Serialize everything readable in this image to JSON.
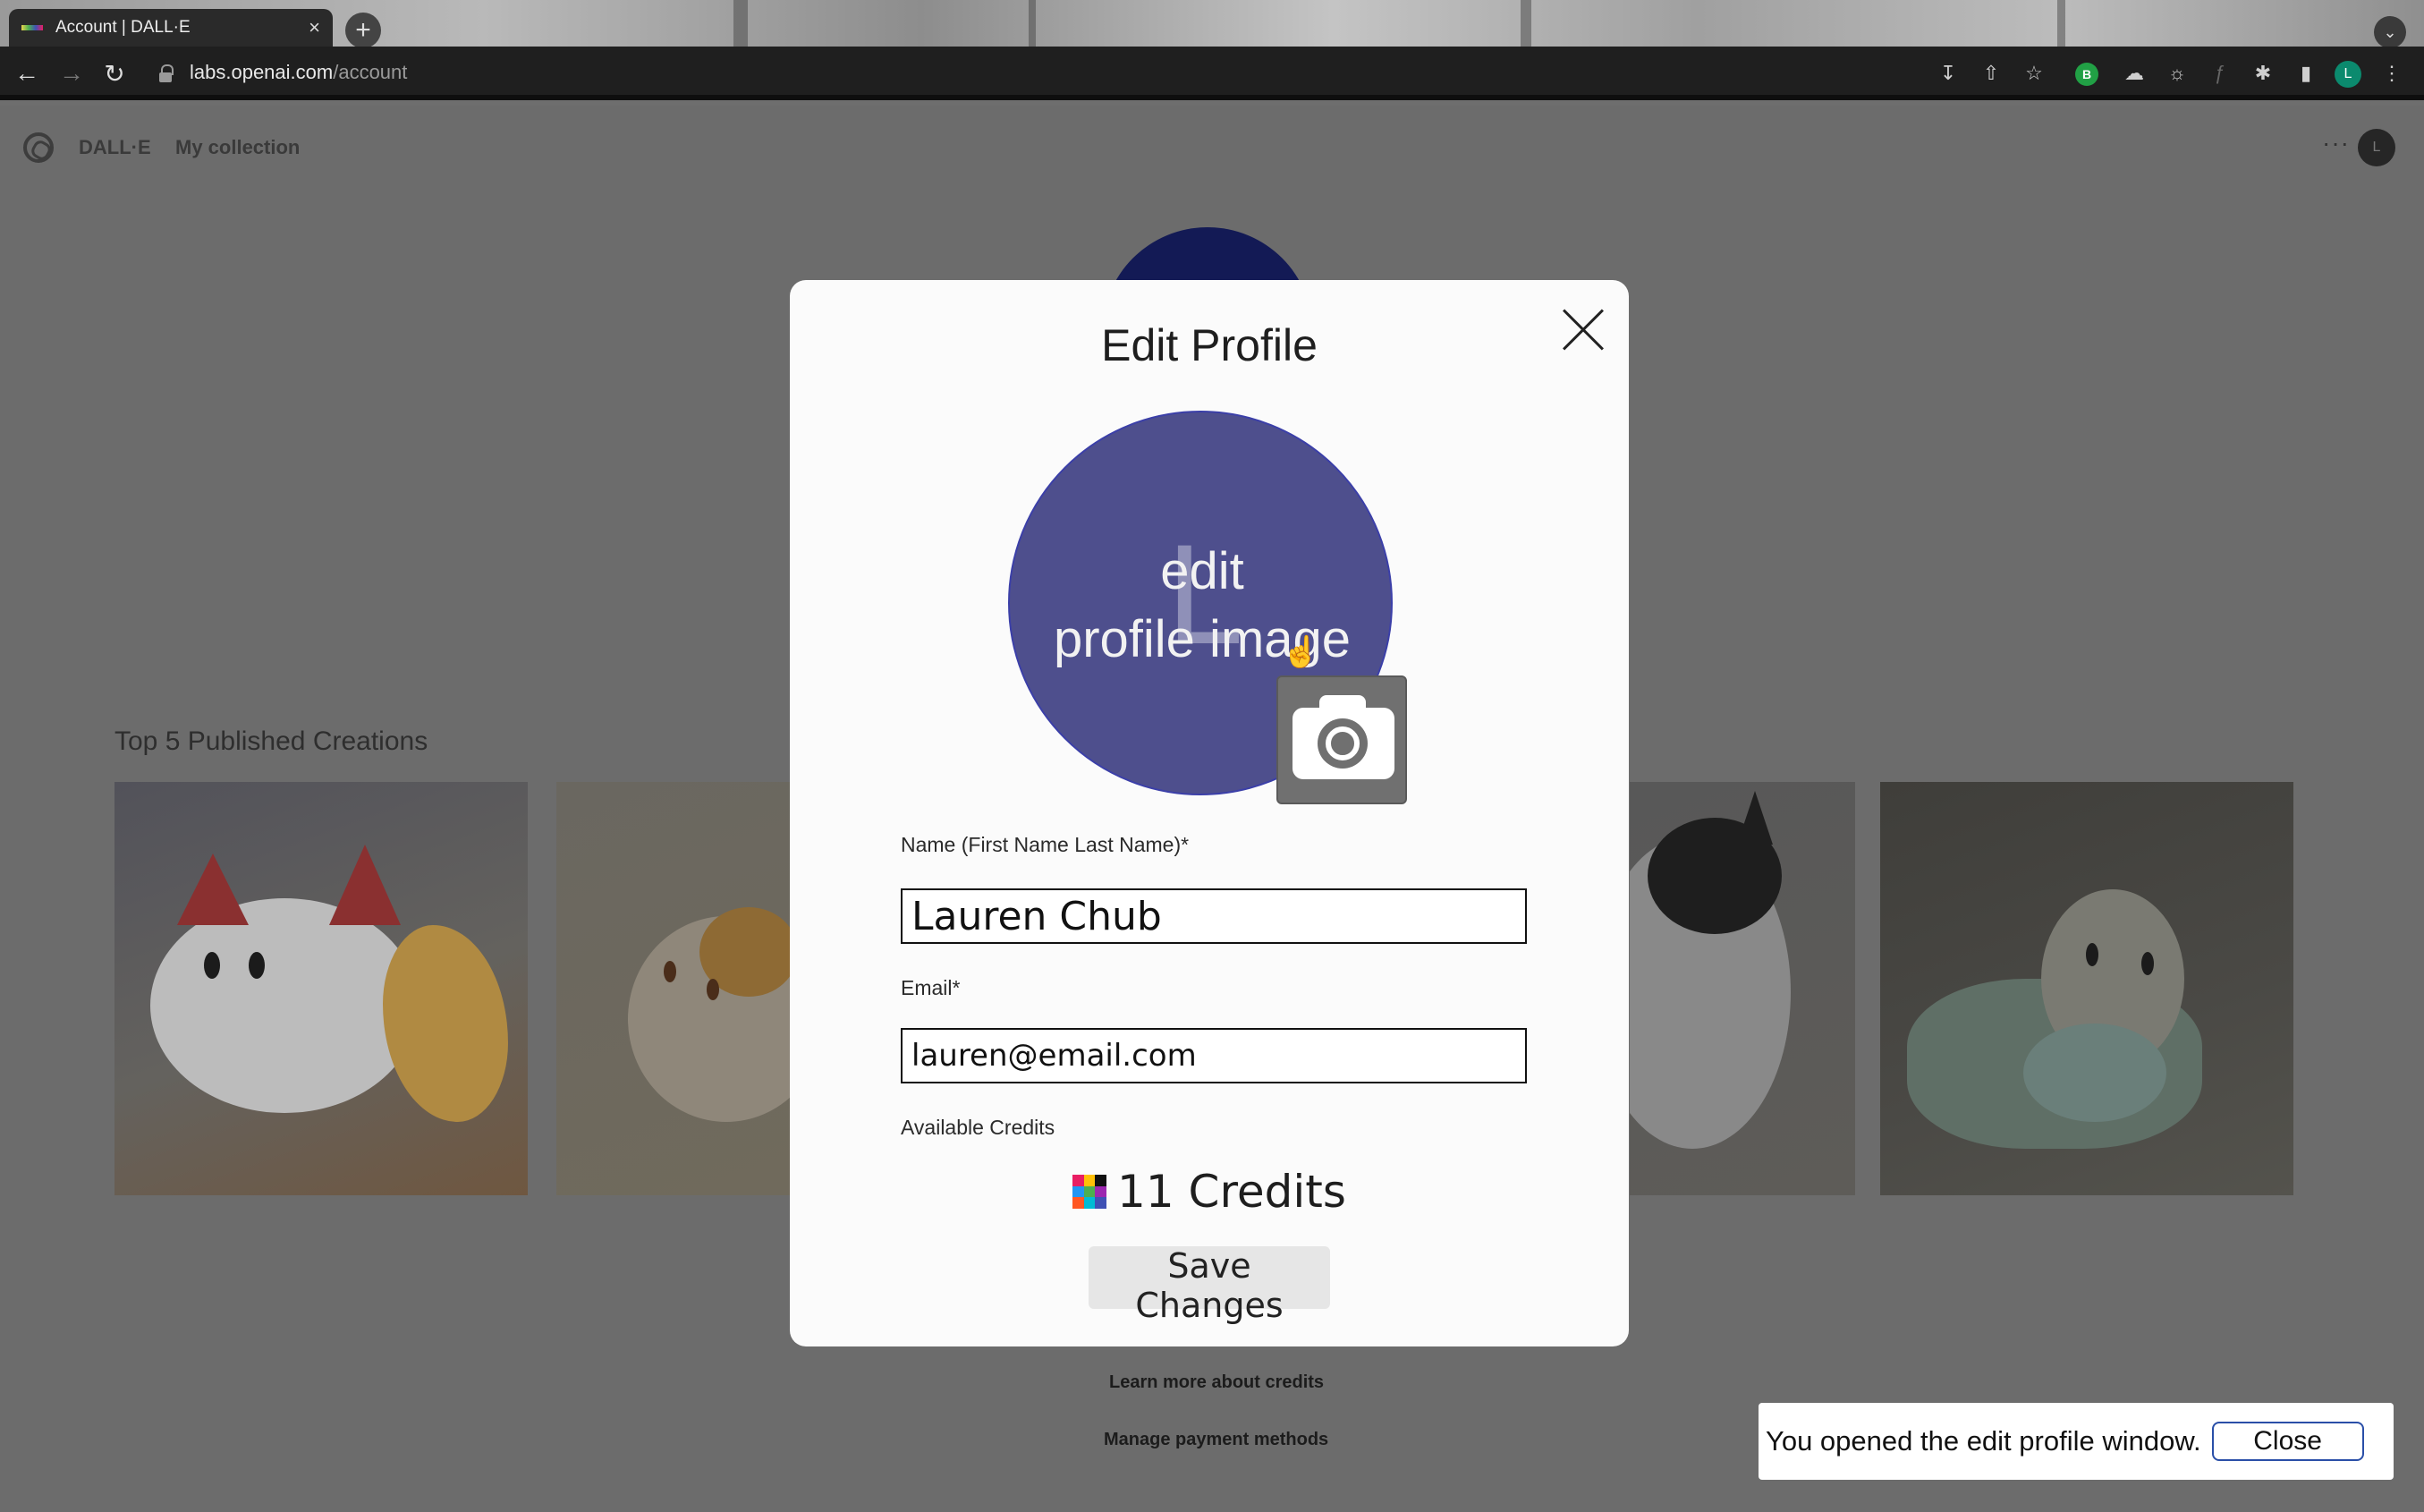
{
  "browser": {
    "tab_title": "Account | DALL·E",
    "tab_close": "×",
    "new_tab": "+",
    "url_host": "labs.openai.com",
    "url_path": "/account",
    "profile_initial": "L"
  },
  "nav": {
    "brand": "DALL·E",
    "my_collection": "My collection",
    "more": "···",
    "avatar_initial": "L"
  },
  "page": {
    "section_title": "Top 5 Published Creations",
    "learn_credits": "Learn more about credits",
    "manage_payment": "Manage payment methods"
  },
  "modal": {
    "title": "Edit Profile",
    "avatar_initial": "L",
    "avatar_overlay_line1": "edit",
    "avatar_overlay_line2": "profile image",
    "name_label": "Name (First Name Last Name)*",
    "name_value": "Lauren Chub",
    "email_label": "Email*",
    "email_value": "lauren@email.com",
    "credits_label": "Available Credits",
    "credits_value": "11 Credits",
    "save_label": "Save Changes"
  },
  "toast": {
    "message": "You opened the edit profile window.",
    "close_label": "Close"
  },
  "colors": {
    "avatar_bg": "#4e4f8d",
    "toast_border": "#2a4fa8",
    "overlay_dim": "#6c6c6c"
  }
}
